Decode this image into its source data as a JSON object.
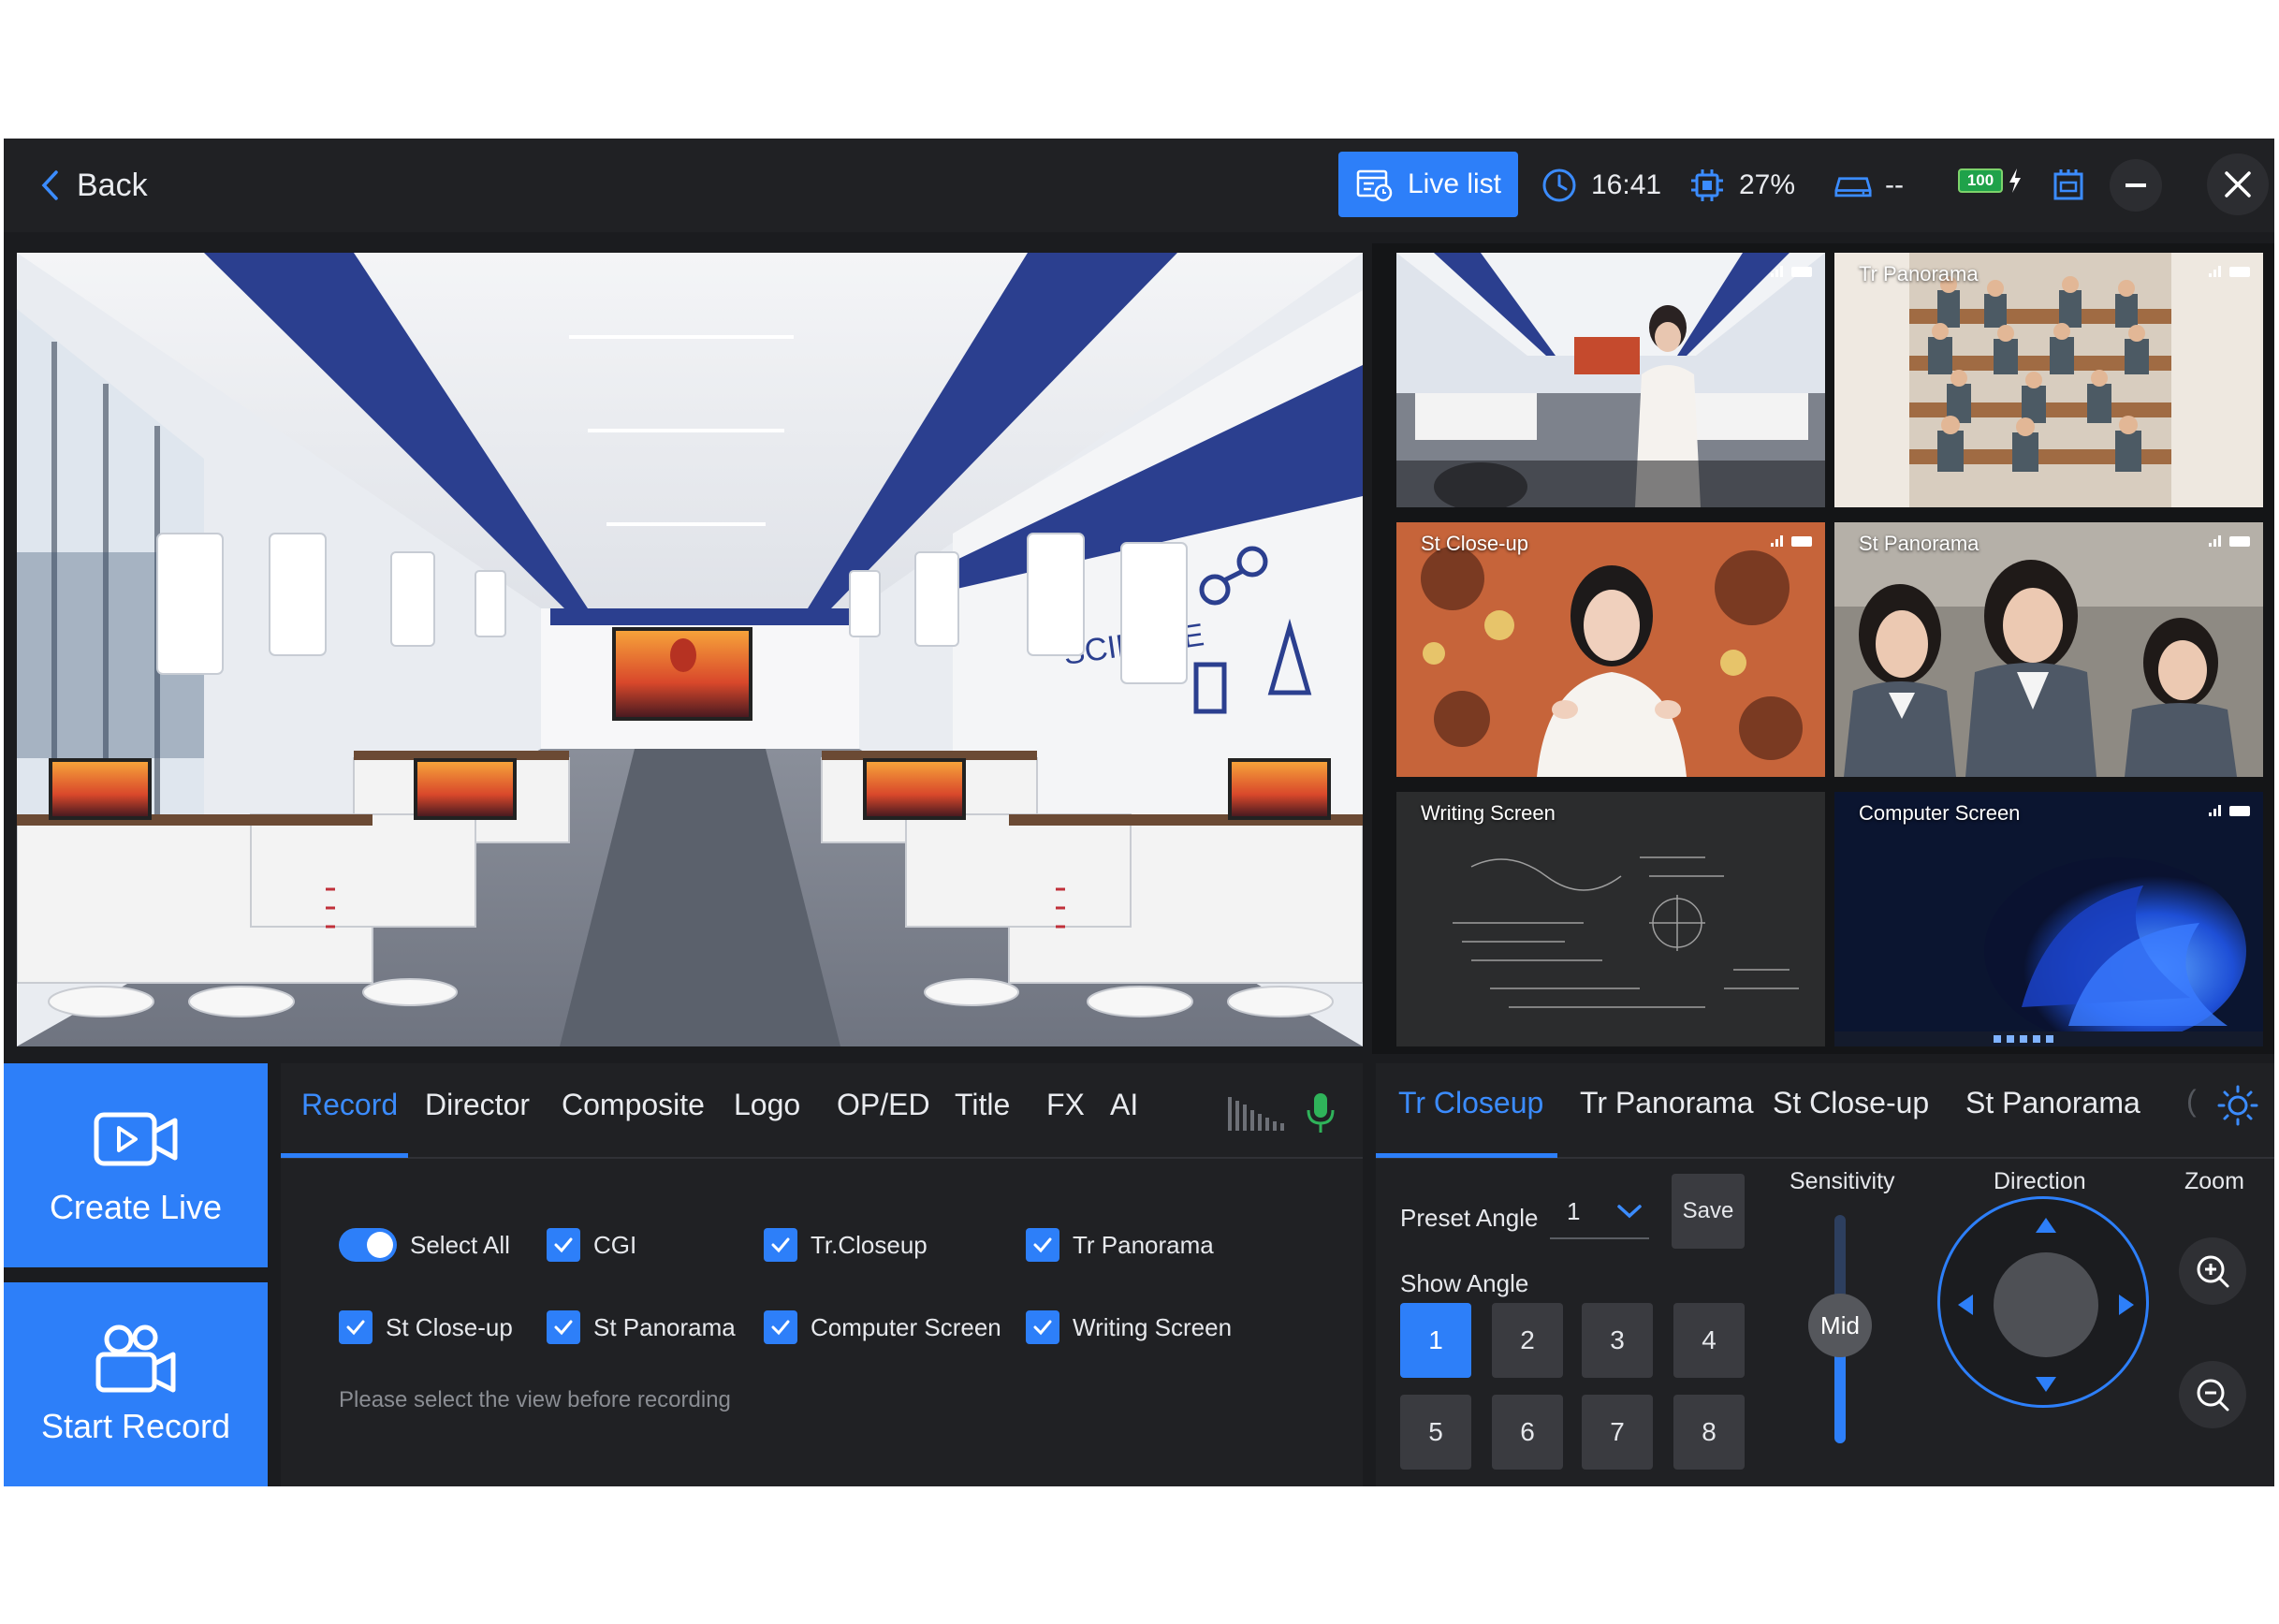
{
  "topbar": {
    "back_label": "Back",
    "live_list_label": "Live list",
    "time": "16:41",
    "cpu": "27%",
    "storage": "--",
    "battery": "100"
  },
  "thumbnails": [
    {
      "label": "",
      "selected": true
    },
    {
      "label": "Tr Panorama",
      "selected": false
    },
    {
      "label": "St Close-up",
      "selected": false
    },
    {
      "label": "St Panorama",
      "selected": false
    },
    {
      "label": "Writing Screen",
      "selected": false
    },
    {
      "label": "Computer Screen",
      "selected": false
    }
  ],
  "actions": {
    "create_live": "Create Live",
    "start_record": "Start Record"
  },
  "record_tabs": [
    "Record",
    "Director",
    "Composite",
    "Logo",
    "OP/ED",
    "Title",
    "FX",
    "AI"
  ],
  "record_active_tab": "Record",
  "record_options": {
    "select_all": "Select All",
    "items": [
      "CGI",
      "Tr.Closeup",
      "Tr Panorama",
      "St Close-up",
      "St Panorama",
      "Computer Screen",
      "Writing Screen"
    ],
    "hint": "Please select the view before recording"
  },
  "camera_tabs": [
    "Tr Closeup",
    "Tr Panorama",
    "St Close-up",
    "St Panorama"
  ],
  "camera_active_tab": "Tr Closeup",
  "camera_controls": {
    "preset_angle_label": "Preset Angle",
    "preset_value": "1",
    "save_label": "Save",
    "show_angle_label": "Show Angle",
    "angles": [
      "1",
      "2",
      "3",
      "4",
      "5",
      "6",
      "7",
      "8"
    ],
    "active_angle": "1",
    "sensitivity_label": "Sensitivity",
    "sensitivity_value": "Mid",
    "direction_label": "Direction",
    "zoom_label": "Zoom"
  },
  "colors": {
    "accent": "#2d7ff9",
    "panel": "#202124",
    "background": "#1b1c1f"
  },
  "icons": [
    "chevron-left-icon",
    "live-list-icon",
    "clock-icon",
    "cpu-icon",
    "storage-icon",
    "battery-icon",
    "charging-icon",
    "sd-card-icon",
    "minimize-icon",
    "close-icon",
    "video-camera-icon",
    "record-camera-icon",
    "microphone-icon",
    "settings-sun-icon",
    "zoom-in-icon",
    "zoom-out-icon"
  ]
}
